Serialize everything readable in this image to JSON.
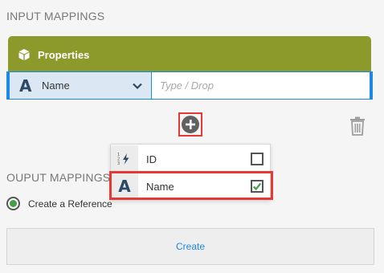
{
  "input_mappings": {
    "title": "INPUT MAPPINGS",
    "properties_header": "Properties",
    "type_select": {
      "label": "Name",
      "icon": "letter-a-icon"
    },
    "drop_field": {
      "placeholder": "Type / Drop",
      "value": ""
    }
  },
  "dropdown": {
    "options": [
      {
        "label": "ID",
        "icon": "numeric-id-icon",
        "checked": false
      },
      {
        "label": "Name",
        "icon": "letter-a-icon",
        "checked": true
      }
    ]
  },
  "output_mappings": {
    "title": "OUPUT MAPPINGS",
    "radio_label": "Create a Reference",
    "radio_selected": true
  },
  "create_button": {
    "label": "Create"
  },
  "colors": {
    "accent_blue": "#1e88e5",
    "header_olive": "#8c9a2c",
    "highlight_red": "#e53935",
    "check_green": "#43a047"
  }
}
